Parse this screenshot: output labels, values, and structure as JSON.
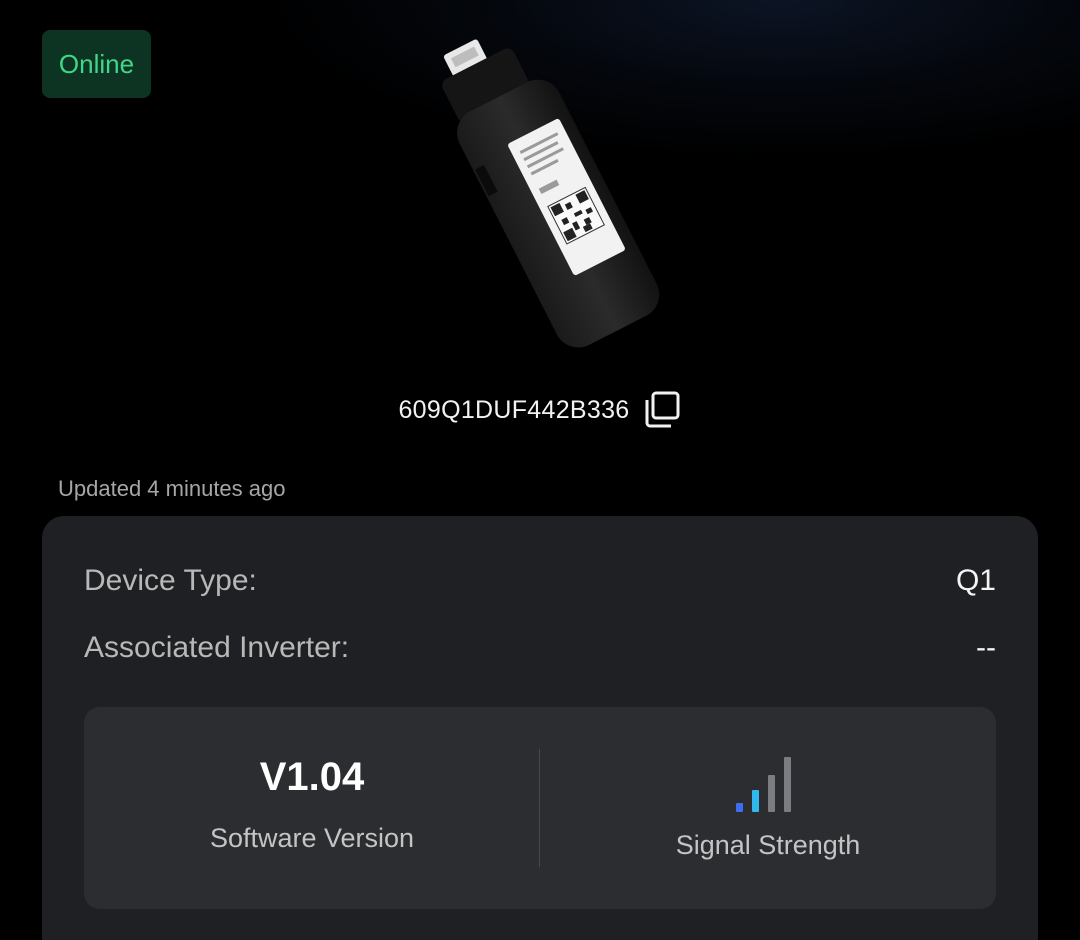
{
  "status": {
    "label": "Online",
    "color": "#3fd78a"
  },
  "device": {
    "serial": "609Q1DUF442B336",
    "image_icon": "wifi-dongle-image",
    "copy_icon": "copy-icon"
  },
  "updated_text": "Updated 4 minutes ago",
  "info": {
    "device_type_label": "Device Type:",
    "device_type_value": "Q1",
    "inverter_label": "Associated Inverter:",
    "inverter_value": "--"
  },
  "stats": {
    "software_version_value": "V1.04",
    "software_version_label": "Software Version",
    "signal_label": "Signal Strength",
    "signal_icon": "signal-strength-icon",
    "signal_bars_active": 2,
    "signal_bars_total": 4,
    "signal_colors": [
      "#3b6ff0",
      "#31b8ec",
      "#7a7d82"
    ]
  }
}
